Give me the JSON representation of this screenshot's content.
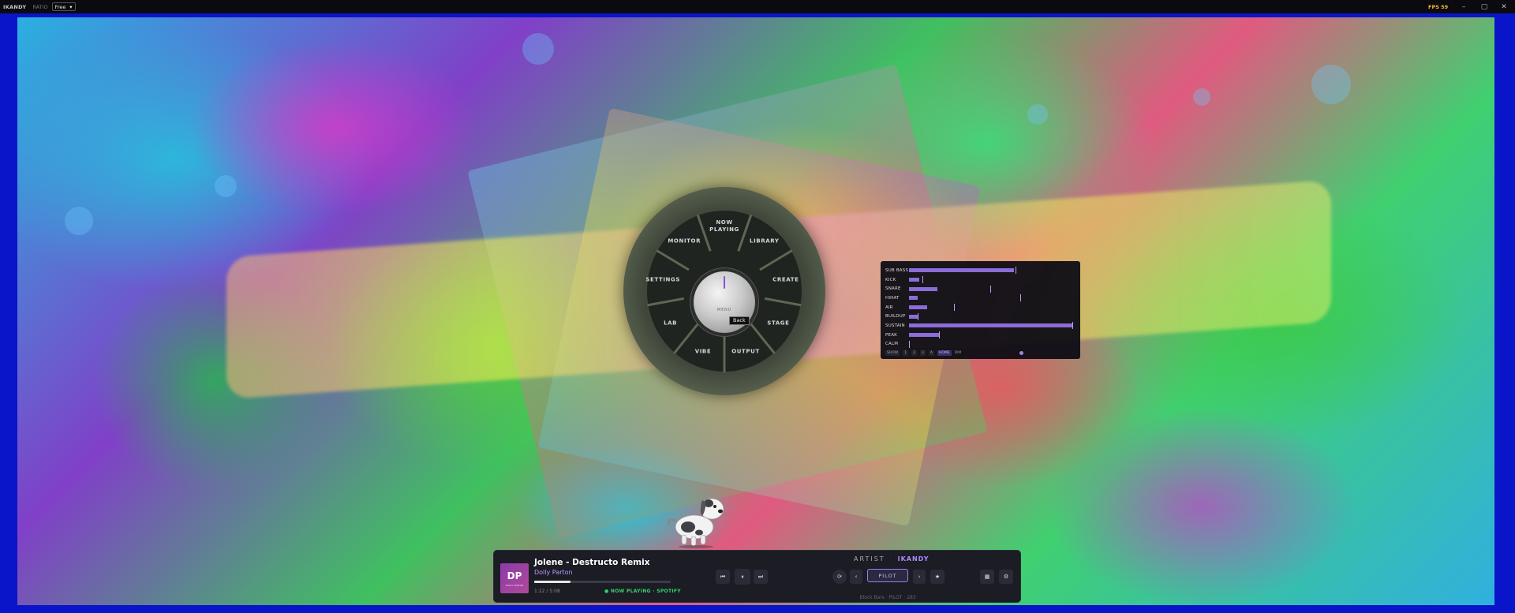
{
  "titlebar": {
    "logo": "IKANDY",
    "ratio_label": "RATIO",
    "ratio_value": "Free",
    "fps": "FPS 59",
    "minimize": "–",
    "maximize": "▢",
    "close": "✕"
  },
  "menu": {
    "items": [
      {
        "id": "now-playing",
        "label": "NOW\nPLAYING"
      },
      {
        "id": "library",
        "label": "LIBRARY"
      },
      {
        "id": "create",
        "label": "CREATE"
      },
      {
        "id": "stage",
        "label": "STAGE"
      },
      {
        "id": "output",
        "label": "OUTPUT"
      },
      {
        "id": "vibe",
        "label": "VIBE"
      },
      {
        "id": "lab",
        "label": "LAB"
      },
      {
        "id": "settings",
        "label": "SETTINGS"
      },
      {
        "id": "monitor",
        "label": "MONITOR"
      }
    ],
    "knob_label": "MENU",
    "tooltip": "Back"
  },
  "meters": {
    "rows": [
      {
        "label": "SUB BASS",
        "level": 0.63,
        "peak": 0.64
      },
      {
        "label": "KICK",
        "level": 0.06,
        "peak": 0.08
      },
      {
        "label": "SNARE",
        "level": 0.17,
        "peak": 0.49
      },
      {
        "label": "HIHAT",
        "level": 0.05,
        "peak": 0.67
      },
      {
        "label": "AIR",
        "level": 0.11,
        "peak": 0.27
      },
      {
        "label": "BUILDUP",
        "level": 0.05,
        "peak": 0.05
      },
      {
        "label": "SUSTAIN",
        "level": 0.98,
        "peak": 0.98
      },
      {
        "label": "PEAK",
        "level": 0.18,
        "peak": 0.18
      },
      {
        "label": "CALM",
        "level": 0.0,
        "peak": 0.0
      }
    ],
    "footer": {
      "show": "SHOW",
      "chips": [
        "1",
        "2",
        "3",
        "A"
      ],
      "home": "HOME",
      "dim": "DIM"
    },
    "accent": "#8b6cd8"
  },
  "player": {
    "cover_initials": "DP",
    "cover_sub": "DOLLY PARTON",
    "title": "Jolene - Destructo Remix",
    "artist": "Dolly Parton",
    "time": "1:22 / 5:08",
    "progress": 0.266,
    "source": "● NOW PLAYING · SPOTIFY",
    "prev": "⏮",
    "pause": "⏸",
    "next": "⏭",
    "mode_left": "ARTIST",
    "mode_sep": "·",
    "mode_right": "IKANDY",
    "pilot": "PILOT",
    "chev_left": "‹",
    "chev_right": "›",
    "preset_info": "Block Bars · PILOT · 283"
  }
}
